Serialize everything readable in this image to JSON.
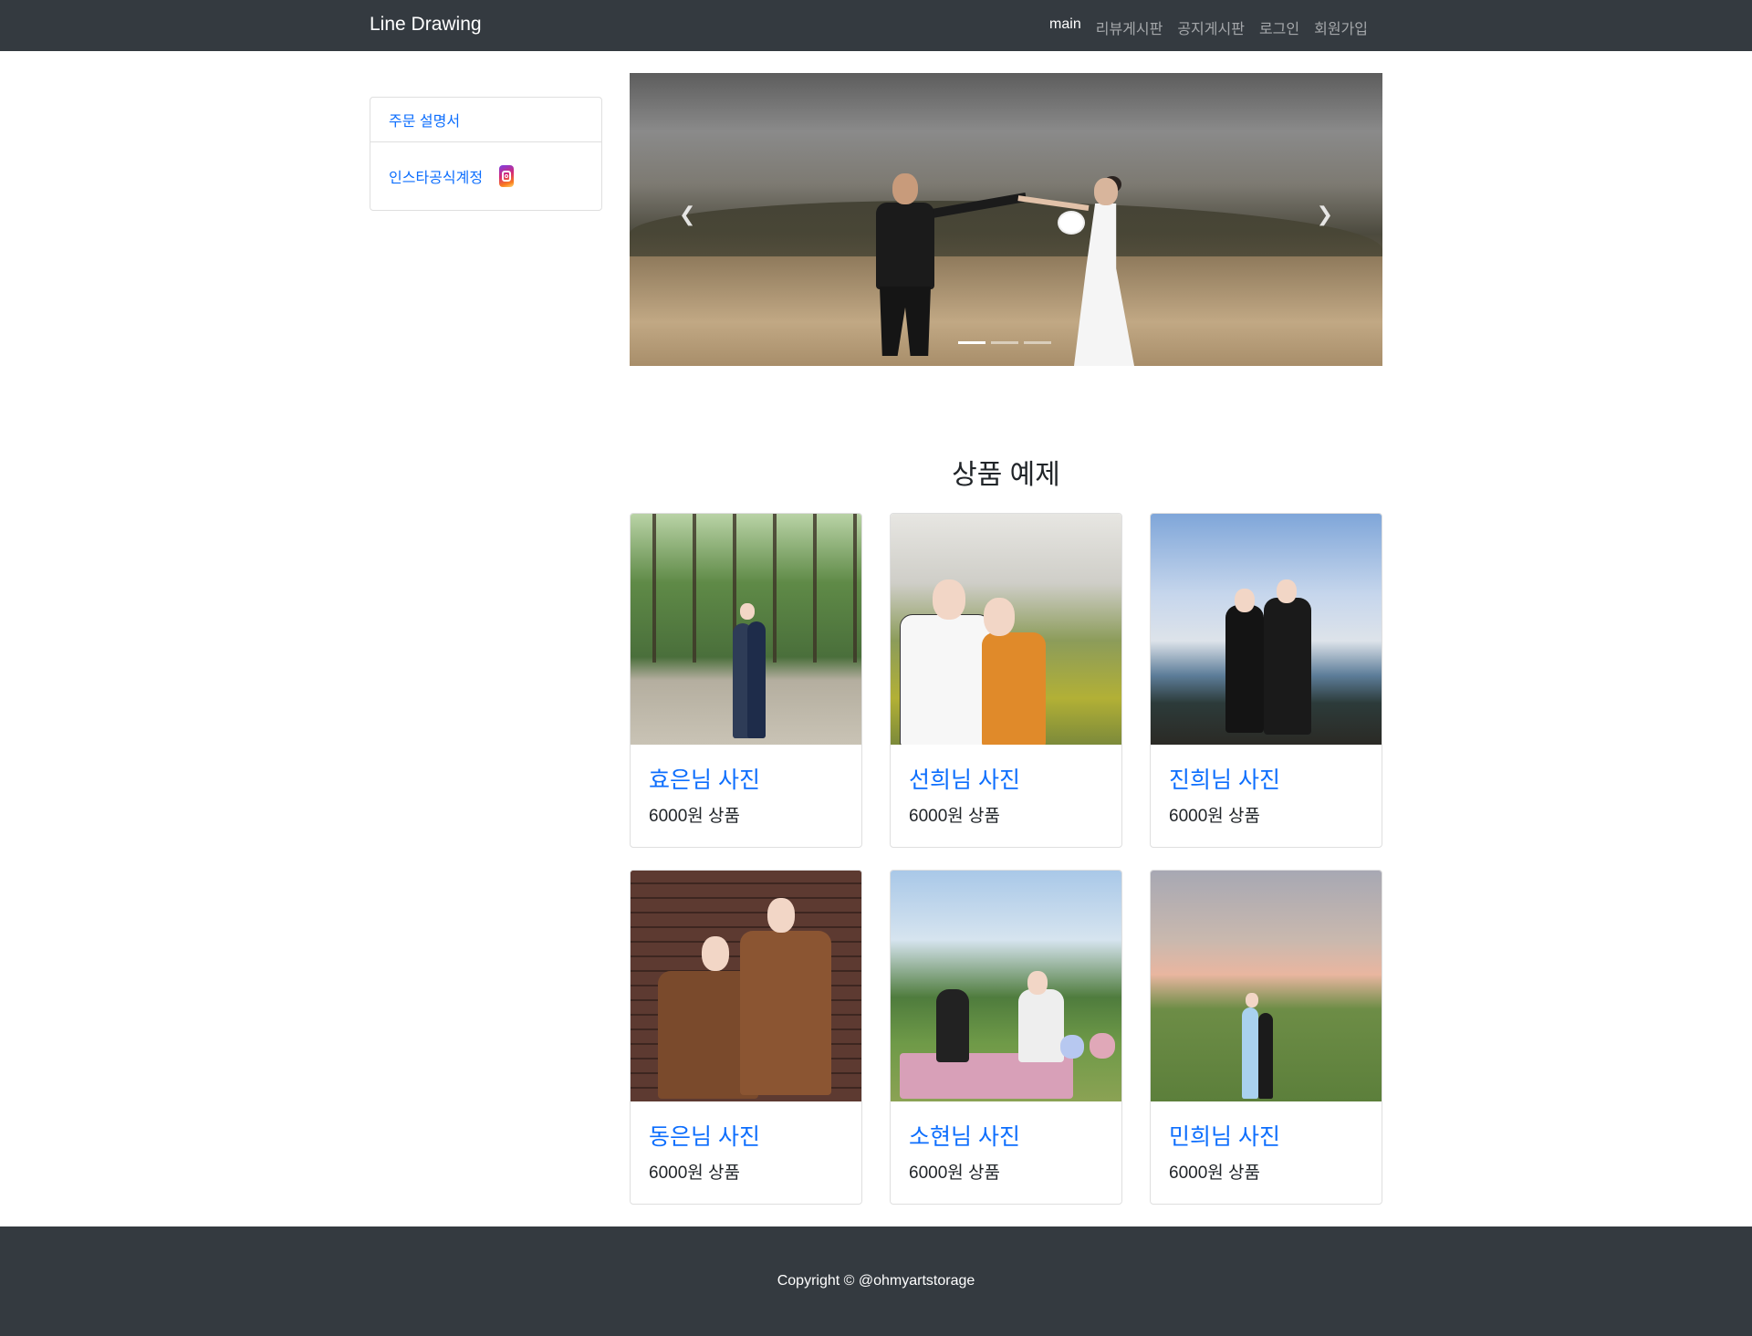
{
  "navbar": {
    "brand": "Line Drawing",
    "links": [
      "main",
      "리뷰게시판",
      "공지게시판",
      "로그인",
      "회원가입"
    ]
  },
  "sidebar": {
    "items": [
      {
        "label": "주문 설명서"
      },
      {
        "label": "인스타공식계정",
        "icon": "instagram-icon"
      }
    ]
  },
  "carousel": {
    "prev_icon": "chevron-left-icon",
    "next_icon": "chevron-right-icon",
    "active_index": 0,
    "slide_count": 3
  },
  "products": {
    "title": "상품 예제",
    "cards": [
      {
        "name": "효은님 사진",
        "price": "6000원 상품"
      },
      {
        "name": "선희님 사진",
        "price": "6000원 상품"
      },
      {
        "name": "진희님 사진",
        "price": "6000원 상품"
      },
      {
        "name": "동은님 사진",
        "price": "6000원 상품"
      },
      {
        "name": "소현님 사진",
        "price": "6000원 상품"
      },
      {
        "name": "민희님 사진",
        "price": "6000원 상품"
      }
    ]
  },
  "footer": {
    "copyright": "Copyright © @ohmyartstorage"
  },
  "colors": {
    "navbar_bg": "#343a40",
    "link": "#0d6efd",
    "footer_bg": "#343a40"
  }
}
